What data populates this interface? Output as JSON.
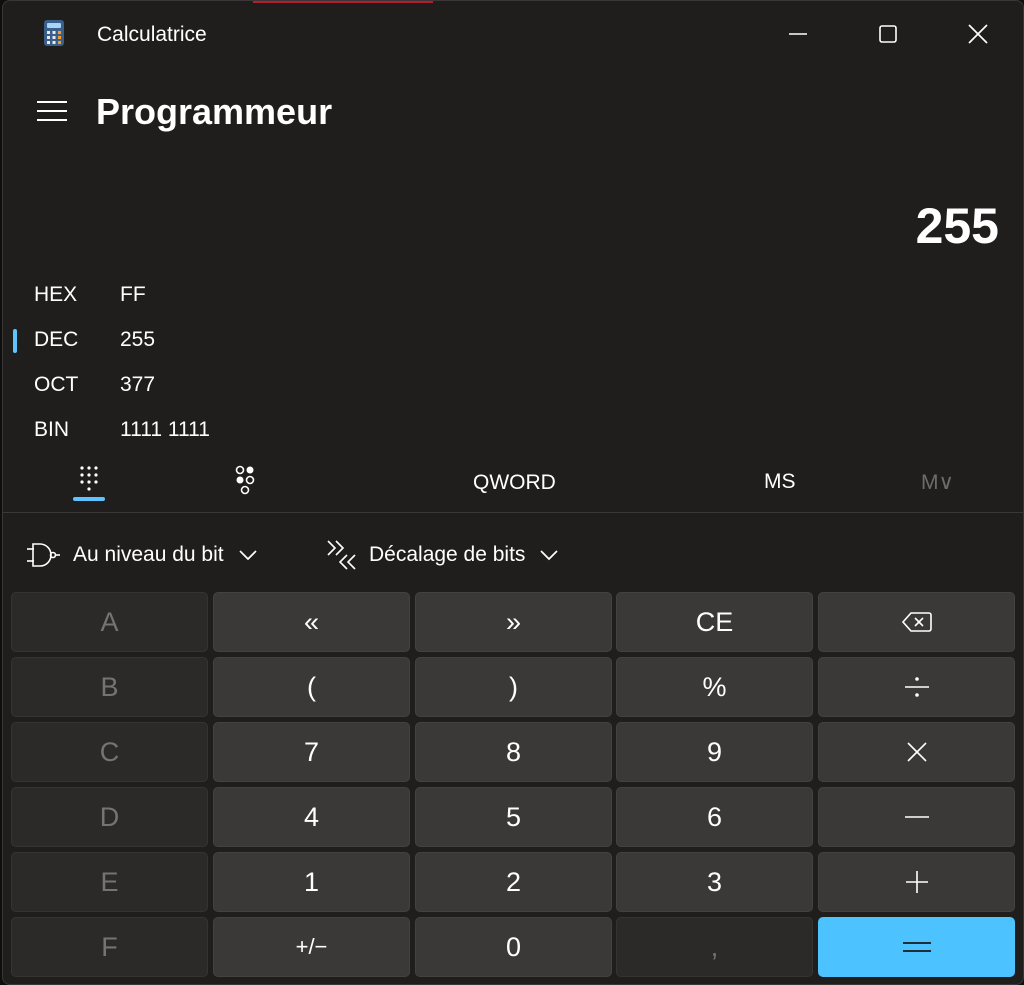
{
  "window": {
    "title": "Calculatrice"
  },
  "header": {
    "mode": "Programmeur"
  },
  "display": {
    "result": "255"
  },
  "radix": [
    {
      "label": "HEX",
      "value": "FF",
      "selected": false
    },
    {
      "label": "DEC",
      "value": "255",
      "selected": true
    },
    {
      "label": "OCT",
      "value": "377",
      "selected": false
    },
    {
      "label": "BIN",
      "value": "1111 1111",
      "selected": false
    }
  ],
  "options": {
    "word_size": "QWORD",
    "memory_store": "MS",
    "memory_list": "M∨"
  },
  "dropdowns": {
    "bitwise": "Au niveau du bit",
    "bitshift": "Décalage de bits"
  },
  "keys": {
    "hex_a": "A",
    "lshift": "«",
    "rshift": "»",
    "ce": "CE",
    "hex_b": "B",
    "lparen": "(",
    "rparen": ")",
    "percent": "%",
    "hex_c": "C",
    "n7": "7",
    "n8": "8",
    "n9": "9",
    "hex_d": "D",
    "n4": "4",
    "n5": "5",
    "n6": "6",
    "hex_e": "E",
    "n1": "1",
    "n2": "2",
    "n3": "3",
    "hex_f": "F",
    "negate": "+/−",
    "n0": "0",
    "decimal": ","
  },
  "colors": {
    "accent": "#4cc2ff",
    "indicator": "#5ec3ff",
    "window_bg": "#201e1c",
    "key_bg": "#3b3937"
  }
}
